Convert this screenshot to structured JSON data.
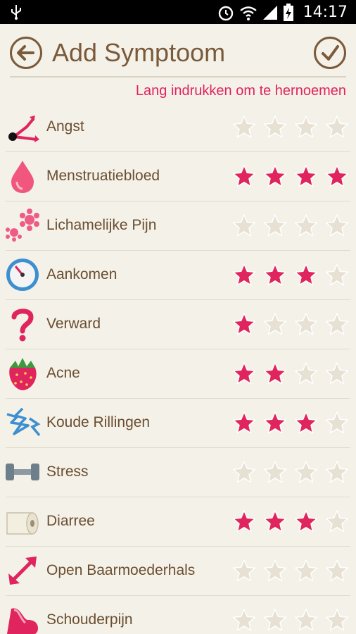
{
  "status_bar": {
    "time": "14:17"
  },
  "app_bar": {
    "title": "Add Symptoom"
  },
  "hint": "Lang indrukken om te hernoemen",
  "colors": {
    "accent": "#e0245e",
    "star_on": "#e0245e",
    "star_off": "#e6e1d3",
    "text": "#6b4e30"
  },
  "max_rating": 4,
  "symptoms": [
    {
      "label": "Angst",
      "icon": "clock-arrow-icon",
      "rating": 0
    },
    {
      "label": "Menstruatiebloed",
      "icon": "blood-drop-icon",
      "rating": 4
    },
    {
      "label": "Lichamelijke Pijn",
      "icon": "flower-icon",
      "rating": 0
    },
    {
      "label": "Aankomen",
      "icon": "scale-dial-icon",
      "rating": 3
    },
    {
      "label": "Verward",
      "icon": "question-mark-icon",
      "rating": 1
    },
    {
      "label": "Acne",
      "icon": "strawberry-icon",
      "rating": 2
    },
    {
      "label": "Koude Rillingen",
      "icon": "lightning-icon",
      "rating": 3
    },
    {
      "label": "Stress",
      "icon": "dumbbell-icon",
      "rating": 0
    },
    {
      "label": "Diarree",
      "icon": "toilet-roll-icon",
      "rating": 3
    },
    {
      "label": "Open Baarmoederhals",
      "icon": "expand-arrows-icon",
      "rating": 0
    },
    {
      "label": "Schouderpijn",
      "icon": "shoulder-icon",
      "rating": 0
    }
  ]
}
